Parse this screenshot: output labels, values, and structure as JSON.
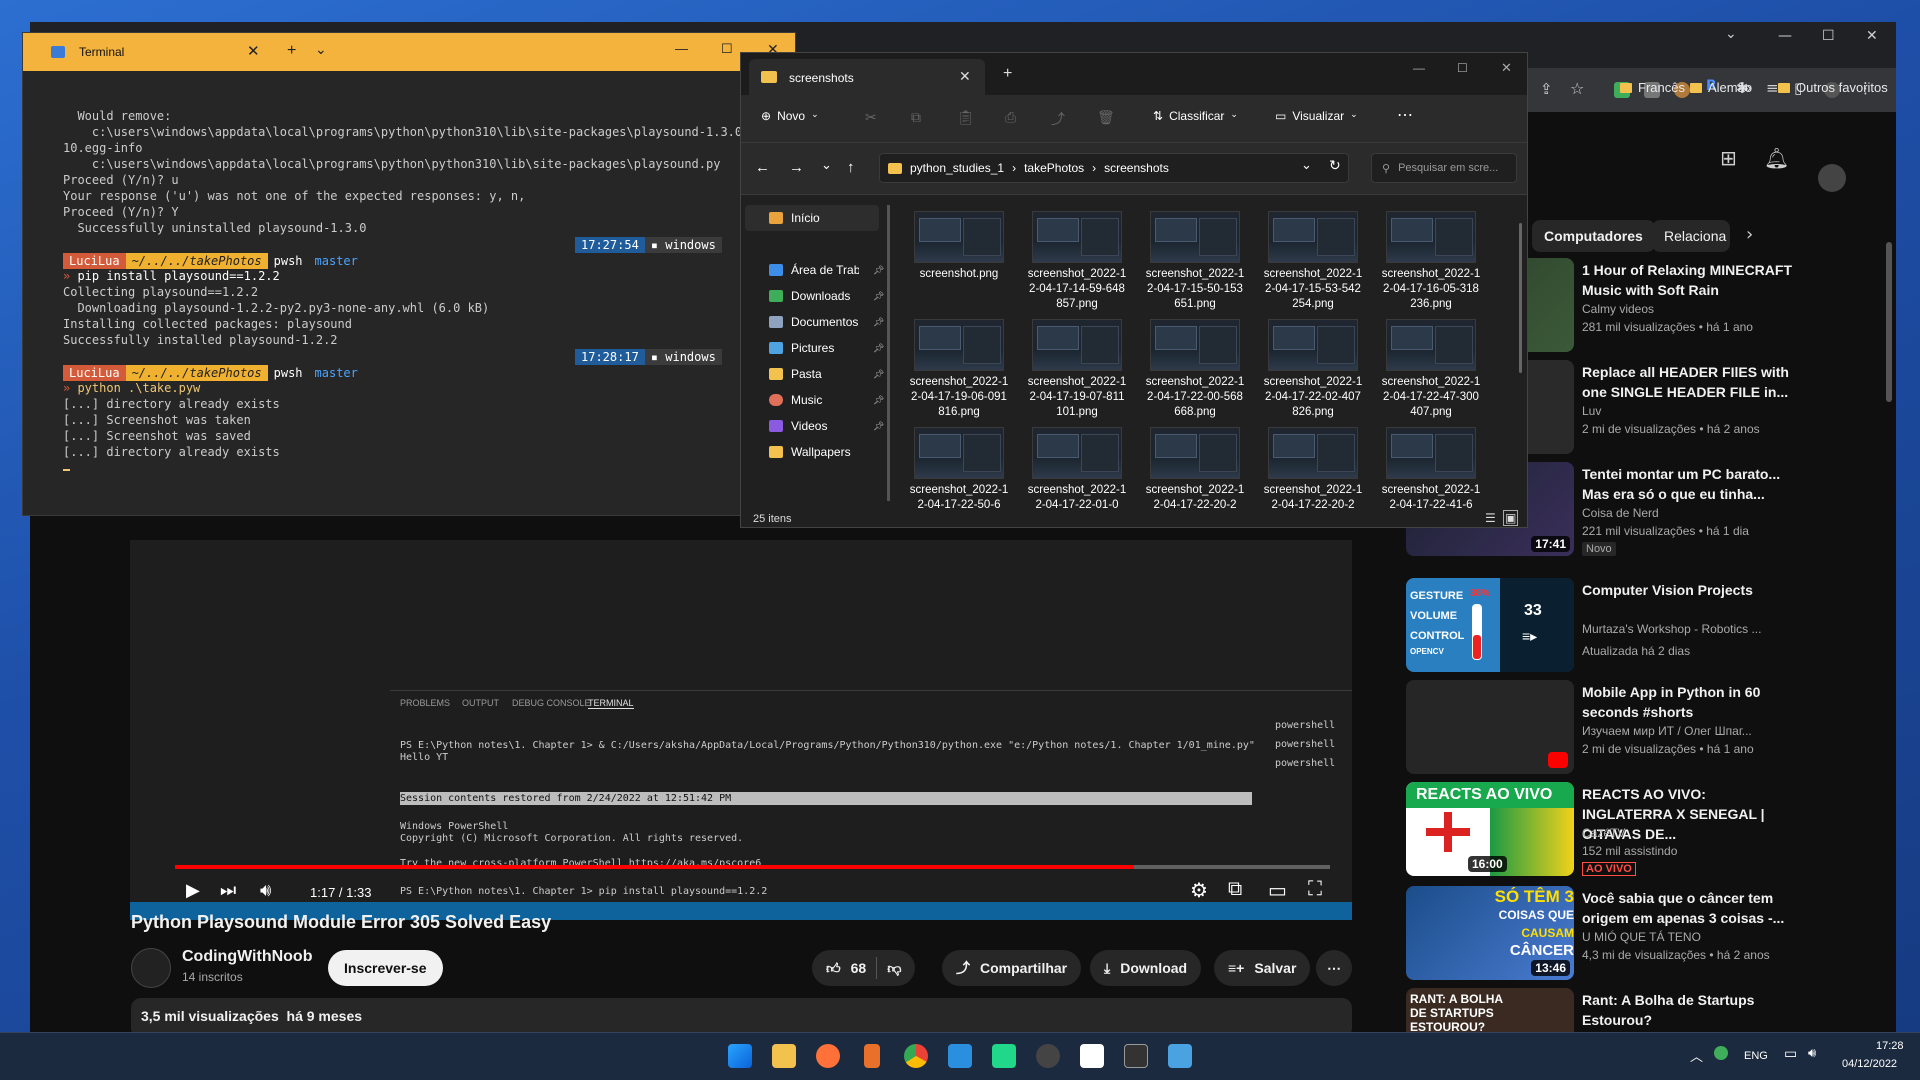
{
  "chrome": {
    "bookmarks": [
      "Francês",
      "Alemão",
      "Outros favoritos"
    ],
    "chips": [
      "Computadores",
      "Relaciona"
    ]
  },
  "video": {
    "title": "Python Playsound Module Error 305 Solved Easy",
    "time": "1:17 / 1:33",
    "progress_fraction": 0.83,
    "channel": "CodingWithNoob",
    "subs": "14 inscritos",
    "subscribe": "Inscrever-se",
    "likes": "68",
    "share": "Compartilhar",
    "download": "Download",
    "save": "Salvar",
    "views_line": "3,5 mil visualizações  há 9 meses",
    "vscode_tabs": [
      "PROBLEMS",
      "OUTPUT",
      "DEBUG CONSOLE",
      "TERMINAL"
    ],
    "vscode_side": [
      "powershell",
      "powershell",
      "powershell"
    ],
    "vscode_lines": [
      "PS E:\\Python notes\\1. Chapter 1> & C:/Users/aksha/AppData/Local/Programs/Python/Python310/python.exe \"e:/Python notes/1. Chapter 1/01_mine.py\"",
      "Hello YT",
      "Session contents restored from 2/24/2022 at 12:51:42 PM",
      "Windows PowerShell",
      "Copyright (C) Microsoft Corporation. All rights reserved.",
      "Try the new cross-platform PowerShell https://aka.ms/pscore6",
      "PS E:\\Python notes\\1. Chapter 1> pip install playsound==1.2.2"
    ]
  },
  "recommendations": [
    {
      "title": "1 Hour of Relaxing MINECRAFT Music with Soft Rain",
      "channel": "Calmy videos",
      "meta": "281 mil visualizações • há 1 ano",
      "duration": ""
    },
    {
      "title": "Replace all HEADER FIlES with one SINGLE HEADER FILE in...",
      "channel": "Luv",
      "meta": "2 mi de visualizações • há 2 anos",
      "duration": ""
    },
    {
      "title": "Tentei montar um PC barato... Mas era só o que eu tinha...",
      "channel": "Coisa de Nerd",
      "meta": "221 mil visualizações • há 1 dia",
      "badge": "Novo",
      "duration": "17:41"
    },
    {
      "title": "Computer Vision Projects",
      "channel": "Murtaza's Workshop - Robotics ...",
      "meta": "Atualizada há 2 dias",
      "duration": "33"
    },
    {
      "title": "Mobile App in Python in 60 seconds #shorts",
      "channel": "Изучаем мир ИТ / Олег Шпаг...",
      "meta": "2 mi de visualizações • há 1 ano",
      "duration": ""
    },
    {
      "title": "REACTS AO VIVO: INGLATERRA X SENEGAL | OITAVAS DE...",
      "channel": "CazéTV",
      "meta": "152 mil assistindo",
      "badge": "AO VIVO",
      "duration": "16:00"
    },
    {
      "title": "Você sabia que o câncer tem origem em apenas 3 coisas -...",
      "channel": "U MIÓ QUE TÁ TENO",
      "meta": "4,3 mi de visualizações • há 2 anos",
      "duration": "13:46"
    },
    {
      "title": "Rant: A Bolha de Startups Estourou?",
      "channel": "",
      "meta": "",
      "duration": ""
    }
  ],
  "thumb_texts": {
    "gesture": [
      "GESTURE",
      "VOLUME",
      "CONTROL",
      "OPENCV",
      "38%"
    ],
    "reacts": "REACTS AO VIVO",
    "cancer": [
      "SÓ TÊM 3",
      "COISAS QUE",
      "CAUSAM",
      "CÂNCER"
    ],
    "rant": [
      "RANT: A BOLHA",
      "DE STARTUPS",
      "ESTOUROU?"
    ]
  },
  "terminal": {
    "tab_title": "Terminal",
    "lines_a": [
      "  Would remove:",
      "    c:\\users\\windows\\appdata\\local\\programs\\python\\python310\\lib\\site-packages\\playsound-1.3.0-py",
      "10.egg-info",
      "    c:\\users\\windows\\appdata\\local\\programs\\python\\python310\\lib\\site-packages\\playsound.py",
      "Proceed (Y/n)? u",
      "Your response ('u') was not one of the expected responses: y, n,",
      "Proceed (Y/n)? Y",
      "  Successfully uninstalled playsound-1.3.0"
    ],
    "prompt_user": "LuciLua",
    "prompt_path": "~/../../takePhotos",
    "prompt_shell": "pwsh",
    "prompt_branch": "master",
    "time1": "17:27:54",
    "time2": "17:28:17",
    "host": "windows",
    "cmd1": "pip install playsound==1.2.2",
    "lines_b": [
      "Collecting playsound==1.2.2",
      "  Downloading playsound-1.2.2-py2.py3-none-any.whl (6.0 kB)",
      "Installing collected packages: playsound",
      "Successfully installed playsound-1.2.2"
    ],
    "cmd2": "python .\\take.pyw",
    "lines_c": [
      "[...] directory already exists",
      "[...] Screenshot was taken",
      "[...] Screenshot was saved",
      "[...] directory already exists"
    ]
  },
  "explorer": {
    "tab_title": "screenshots",
    "new_label": "Novo",
    "sort_label": "Classificar",
    "view_label": "Visualizar",
    "breadcrumb": [
      "python_studies_1",
      "takePhotos",
      "screenshots"
    ],
    "search_placeholder": "Pesquisar em scre...",
    "nav": [
      {
        "label": "Início",
        "color": "#e8a33d"
      },
      {
        "label": "Área de Trab",
        "color": "#3d8ee8"
      },
      {
        "label": "Downloads",
        "color": "#3fae5a"
      },
      {
        "label": "Documentos",
        "color": "#8fa3bf"
      },
      {
        "label": "Pictures",
        "color": "#4fa3e0"
      },
      {
        "label": "Pasta",
        "color": "#f2c14e"
      },
      {
        "label": "Music",
        "color": "#e0705a"
      },
      {
        "label": "Videos",
        "color": "#8a5ae0"
      },
      {
        "label": "Wallpapers",
        "color": "#f2c14e"
      }
    ],
    "files": [
      "screenshot.png",
      "screenshot_2022-12-04-17-14-59-648857.png",
      "screenshot_2022-12-04-17-15-50-153651.png",
      "screenshot_2022-12-04-17-15-53-542254.png",
      "screenshot_2022-12-04-17-16-05-318236.png",
      "screenshot_2022-12-04-17-19-06-091816.png",
      "screenshot_2022-12-04-17-19-07-811101.png",
      "screenshot_2022-12-04-17-22-00-568668.png",
      "screenshot_2022-12-04-17-22-02-407826.png",
      "screenshot_2022-12-04-17-22-47-300407.png",
      "screenshot_2022-12-04-17-22-50-6",
      "screenshot_2022-12-04-17-22-01-0",
      "screenshot_2022-12-04-17-22-20-2",
      "screenshot_2022-12-04-17-22-20-2",
      "screenshot_2022-12-04-17-22-41-6"
    ],
    "status": "25 itens"
  },
  "taskbar": {
    "lang": "ENG",
    "time": "17:28",
    "date": "04/12/2022"
  }
}
